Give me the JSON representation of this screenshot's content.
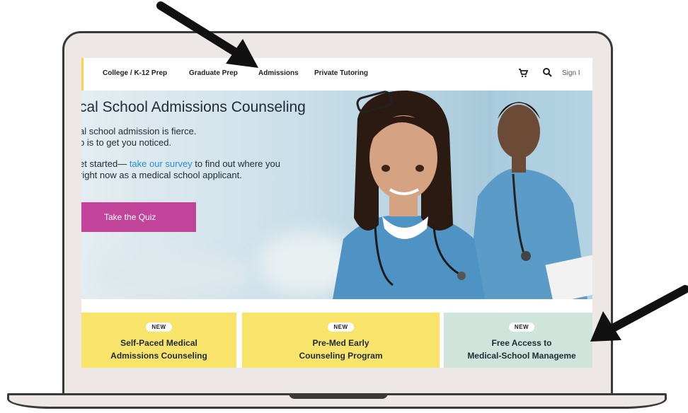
{
  "nav": {
    "items": [
      "College / K-12 Prep",
      "Graduate Prep",
      "Admissions",
      "Private Tutoring"
    ],
    "signin": "Sign I"
  },
  "hero": {
    "title": "cal School Admissions Counseling",
    "line1": "al school admission is fierce.",
    "line2": "b is to get you noticed.",
    "line3_pre": "et started— ",
    "line3_link": "take our survey",
    "line3_post": " to find out where you",
    "line4": "right now as a medical school applicant.",
    "button": "Take the Quiz"
  },
  "cards": [
    {
      "badge": "NEW",
      "line1": "Self-Paced Medical",
      "line2": "Admissions Counseling"
    },
    {
      "badge": "NEW",
      "line1": "Pre-Med Early",
      "line2": "Counseling Program"
    },
    {
      "badge": "NEW",
      "line1": "Free Access to",
      "line2": "Medical-School Manageme"
    }
  ],
  "icons": {
    "cart": "cart-icon",
    "search": "search-icon",
    "arrow_top": "pointer-arrow-icon",
    "arrow_right": "pointer-arrow-icon"
  },
  "colors": {
    "accent_pink": "#c2449a",
    "link_blue": "#2a8cd4",
    "card_yellow": "#f8e46b",
    "card_mint": "#cfe5dc",
    "frame": "#ede8e5"
  }
}
